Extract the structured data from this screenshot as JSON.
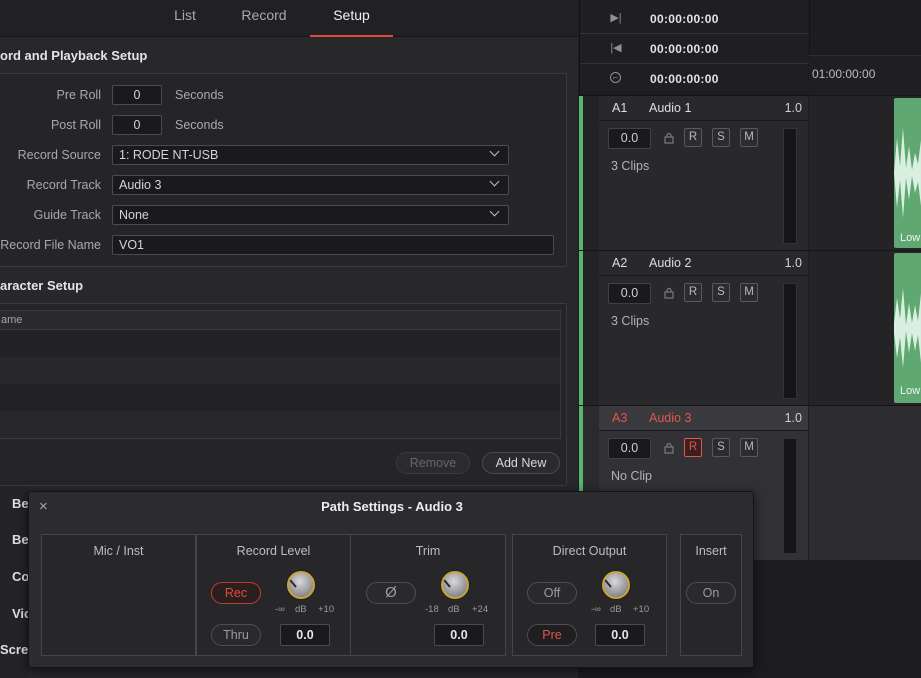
{
  "tabs": [
    "List",
    "Record",
    "Setup"
  ],
  "record_setup": {
    "title": "ord and Playback Setup",
    "pre_roll_label": "Pre Roll",
    "pre_roll_value": "0",
    "post_roll_label": "Post Roll",
    "post_roll_value": "0",
    "seconds_label": "Seconds",
    "record_source_label": "Record Source",
    "record_source_value": "1: RODE NT-USB",
    "record_track_label": "Record Track",
    "record_track_value": "Audio 3",
    "guide_track_label": "Guide Track",
    "guide_track_value": "None",
    "file_name_label": "Record File Name",
    "file_name_value": "VO1"
  },
  "character_setup": {
    "title": "aracter Setup",
    "column_header": "ame",
    "remove_label": "Remove",
    "add_new_label": "Add New"
  },
  "sidebar_items": [
    "Be",
    "Be",
    "Co",
    "Vic",
    "Scre"
  ],
  "timecodes": [
    "00:00:00:00",
    "00:00:00:00",
    "00:00:00:00"
  ],
  "ruler_timecode": "01:00:00:00",
  "tracks": [
    {
      "id": "A1",
      "name": "Audio 1",
      "value": "1.0",
      "volume": "0.0",
      "clips": "3 Clips",
      "armed": false
    },
    {
      "id": "A2",
      "name": "Audio 2",
      "value": "1.0",
      "volume": "0.0",
      "clips": "3 Clips",
      "armed": false
    },
    {
      "id": "A3",
      "name": "Audio 3",
      "value": "1.0",
      "volume": "0.0",
      "clips": "No Clip",
      "armed": true
    }
  ],
  "track_buttons": [
    "R",
    "S",
    "M"
  ],
  "clip_label": "Low",
  "path_settings": {
    "title": "Path Settings - Audio 3",
    "mic_inst": "Mic / Inst",
    "record_level": {
      "title": "Record Level",
      "rec": "Rec",
      "thru": "Thru",
      "min": "-∞",
      "unit": "dB",
      "max": "+10",
      "value": "0.0"
    },
    "trim": {
      "title": "Trim",
      "phase": "Ø",
      "min": "-18",
      "unit": "dB",
      "max": "+24",
      "value": "0.0"
    },
    "direct_output": {
      "title": "Direct Output",
      "off": "Off",
      "pre": "Pre",
      "min": "-∞",
      "unit": "dB",
      "max": "+10",
      "value": "0.0"
    },
    "insert": {
      "title": "Insert",
      "on": "On"
    }
  },
  "colors": {
    "accent": "#d84b3e",
    "track_green": "#5ab56e",
    "armed_red": "#e0564a",
    "knob_ring": "#c9a43c"
  }
}
